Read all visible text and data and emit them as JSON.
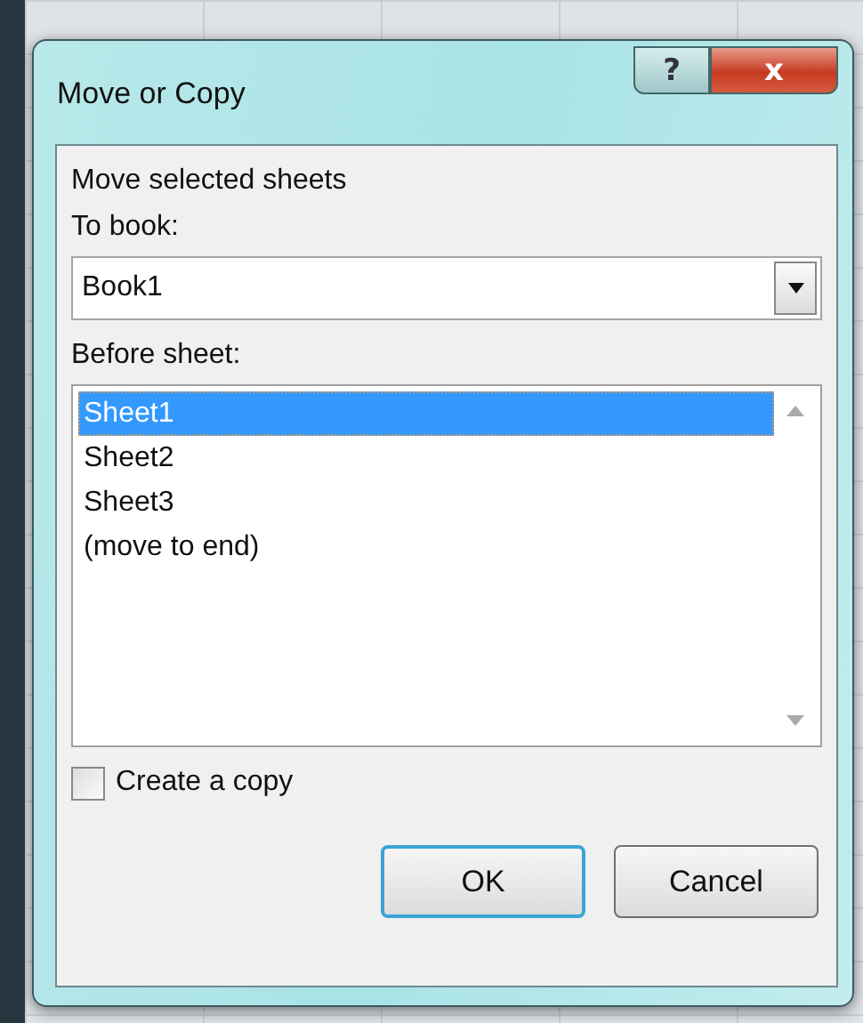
{
  "window": {
    "title": "Move or Copy",
    "help_button": "?",
    "close_button": "x"
  },
  "prompt": "Move selected sheets",
  "to_book": {
    "label": "To book:",
    "value": "Book1"
  },
  "before_sheet": {
    "label": "Before sheet:",
    "items": [
      {
        "label": "Sheet1",
        "selected": true
      },
      {
        "label": "Sheet2",
        "selected": false
      },
      {
        "label": "Sheet3",
        "selected": false
      },
      {
        "label": "(move to end)",
        "selected": false
      }
    ]
  },
  "create_copy": {
    "label": "Create a copy",
    "checked": false
  },
  "buttons": [
    {
      "label": "OK",
      "default": true
    },
    {
      "label": "Cancel",
      "default": false
    }
  ]
}
